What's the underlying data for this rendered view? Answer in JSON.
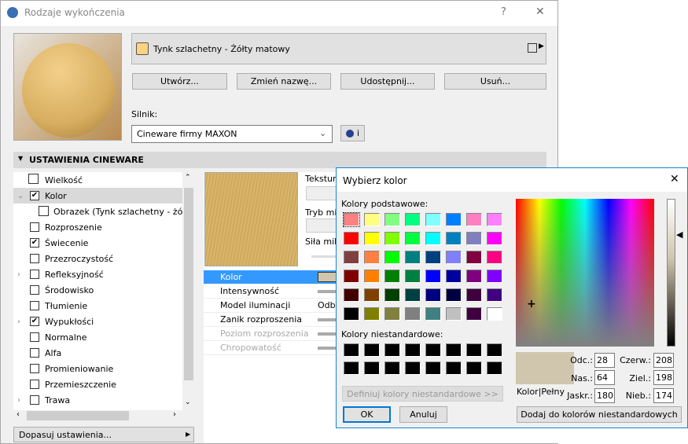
{
  "window": {
    "title": "Rodzaje wykończenia",
    "help": "?",
    "close": "✕"
  },
  "material": {
    "name": "Tynk szlachetny - Żółty matowy",
    "swatch_color": "#FFD27F"
  },
  "buttons": {
    "create": "Utwórz...",
    "rename": "Zmień nazwę...",
    "share": "Udostępnij...",
    "delete": "Usuń..."
  },
  "engine": {
    "label": "Silnik:",
    "value": "Cineware firmy MAXON",
    "info": "i"
  },
  "section": {
    "title": "USTAWIENIA CINEWARE"
  },
  "tree": [
    {
      "label": "Wielkość",
      "checked": null,
      "expander": ""
    },
    {
      "label": "Kolor",
      "checked": true,
      "expander": "⌄",
      "selected": true
    },
    {
      "label": "Obrazek (Tynk szlachetny - żółty",
      "checked": null,
      "expander": "",
      "child": true
    },
    {
      "label": "Rozproszenie",
      "checked": false,
      "expander": ""
    },
    {
      "label": "Świecenie",
      "checked": true,
      "expander": ""
    },
    {
      "label": "Przezroczystość",
      "checked": false,
      "expander": ""
    },
    {
      "label": "Refleksyjność",
      "checked": false,
      "expander": "›"
    },
    {
      "label": "Środowisko",
      "checked": false,
      "expander": ""
    },
    {
      "label": "Tłumienie",
      "checked": false,
      "expander": ""
    },
    {
      "label": "Wypukłości",
      "checked": true,
      "expander": "›"
    },
    {
      "label": "Normalne",
      "checked": false,
      "expander": ""
    },
    {
      "label": "Alfa",
      "checked": false,
      "expander": ""
    },
    {
      "label": "Promieniowanie",
      "checked": false,
      "expander": ""
    },
    {
      "label": "Przemieszczenie",
      "checked": false,
      "expander": ""
    },
    {
      "label": "Trawa",
      "checked": false,
      "expander": "›"
    }
  ],
  "adjust_button": "Dopasuj ustawienia...",
  "texture_labels": {
    "texture": "Tekstura",
    "micro_mode": "Tryb mik",
    "micro_strength": "Siła mik"
  },
  "properties": [
    {
      "name": "Kolor",
      "value": "",
      "selected": true
    },
    {
      "name": "Intensywność",
      "value": ""
    },
    {
      "name": "Model iluminacji",
      "value": "Odb"
    },
    {
      "name": "Zanik rozproszenia",
      "value": ""
    },
    {
      "name": "Poziom rozproszenia",
      "value": "",
      "disabled": true
    },
    {
      "name": "Chropowatość",
      "value": "",
      "disabled": true
    }
  ],
  "color_dialog": {
    "title": "Wybierz kolor",
    "basic_label": "Kolory podstawowe:",
    "custom_label": "Kolory niestandardowe:",
    "basic_colors": [
      "#FF8080",
      "#FFFF80",
      "#80FF80",
      "#00FF80",
      "#80FFFF",
      "#0080FF",
      "#FF80C0",
      "#FF80FF",
      "#FF0000",
      "#FFFF00",
      "#80FF00",
      "#00FF40",
      "#00FFFF",
      "#0080C0",
      "#8080C0",
      "#FF00FF",
      "#804040",
      "#FF8040",
      "#00FF00",
      "#008080",
      "#004080",
      "#8080FF",
      "#800040",
      "#FF0080",
      "#800000",
      "#FF8000",
      "#008000",
      "#008040",
      "#0000FF",
      "#0000A0",
      "#800080",
      "#8000FF",
      "#400000",
      "#804000",
      "#004000",
      "#004040",
      "#000080",
      "#000040",
      "#400040",
      "#400080",
      "#000000",
      "#808000",
      "#808040",
      "#808080",
      "#408080",
      "#C0C0C0",
      "#400040",
      "#FFFFFF"
    ],
    "define_custom": "Definiuj kolory niestandardowe >>",
    "ok": "OK",
    "cancel": "Anuluj",
    "preview_label": "Kolor|Pełny",
    "current_color": "#D0C6AE",
    "hue_label": "Odc.:",
    "hue": "28",
    "sat_label": "Nas.:",
    "sat": "64",
    "lum_label": "Jaskr.:",
    "lum": "180",
    "red_label": "Czerw.:",
    "red": "208",
    "green_label": "Ziel.:",
    "green": "198",
    "blue_label": "Nieb.:",
    "blue": "174",
    "add_custom": "Dodaj do kolorów niestandardowych"
  }
}
